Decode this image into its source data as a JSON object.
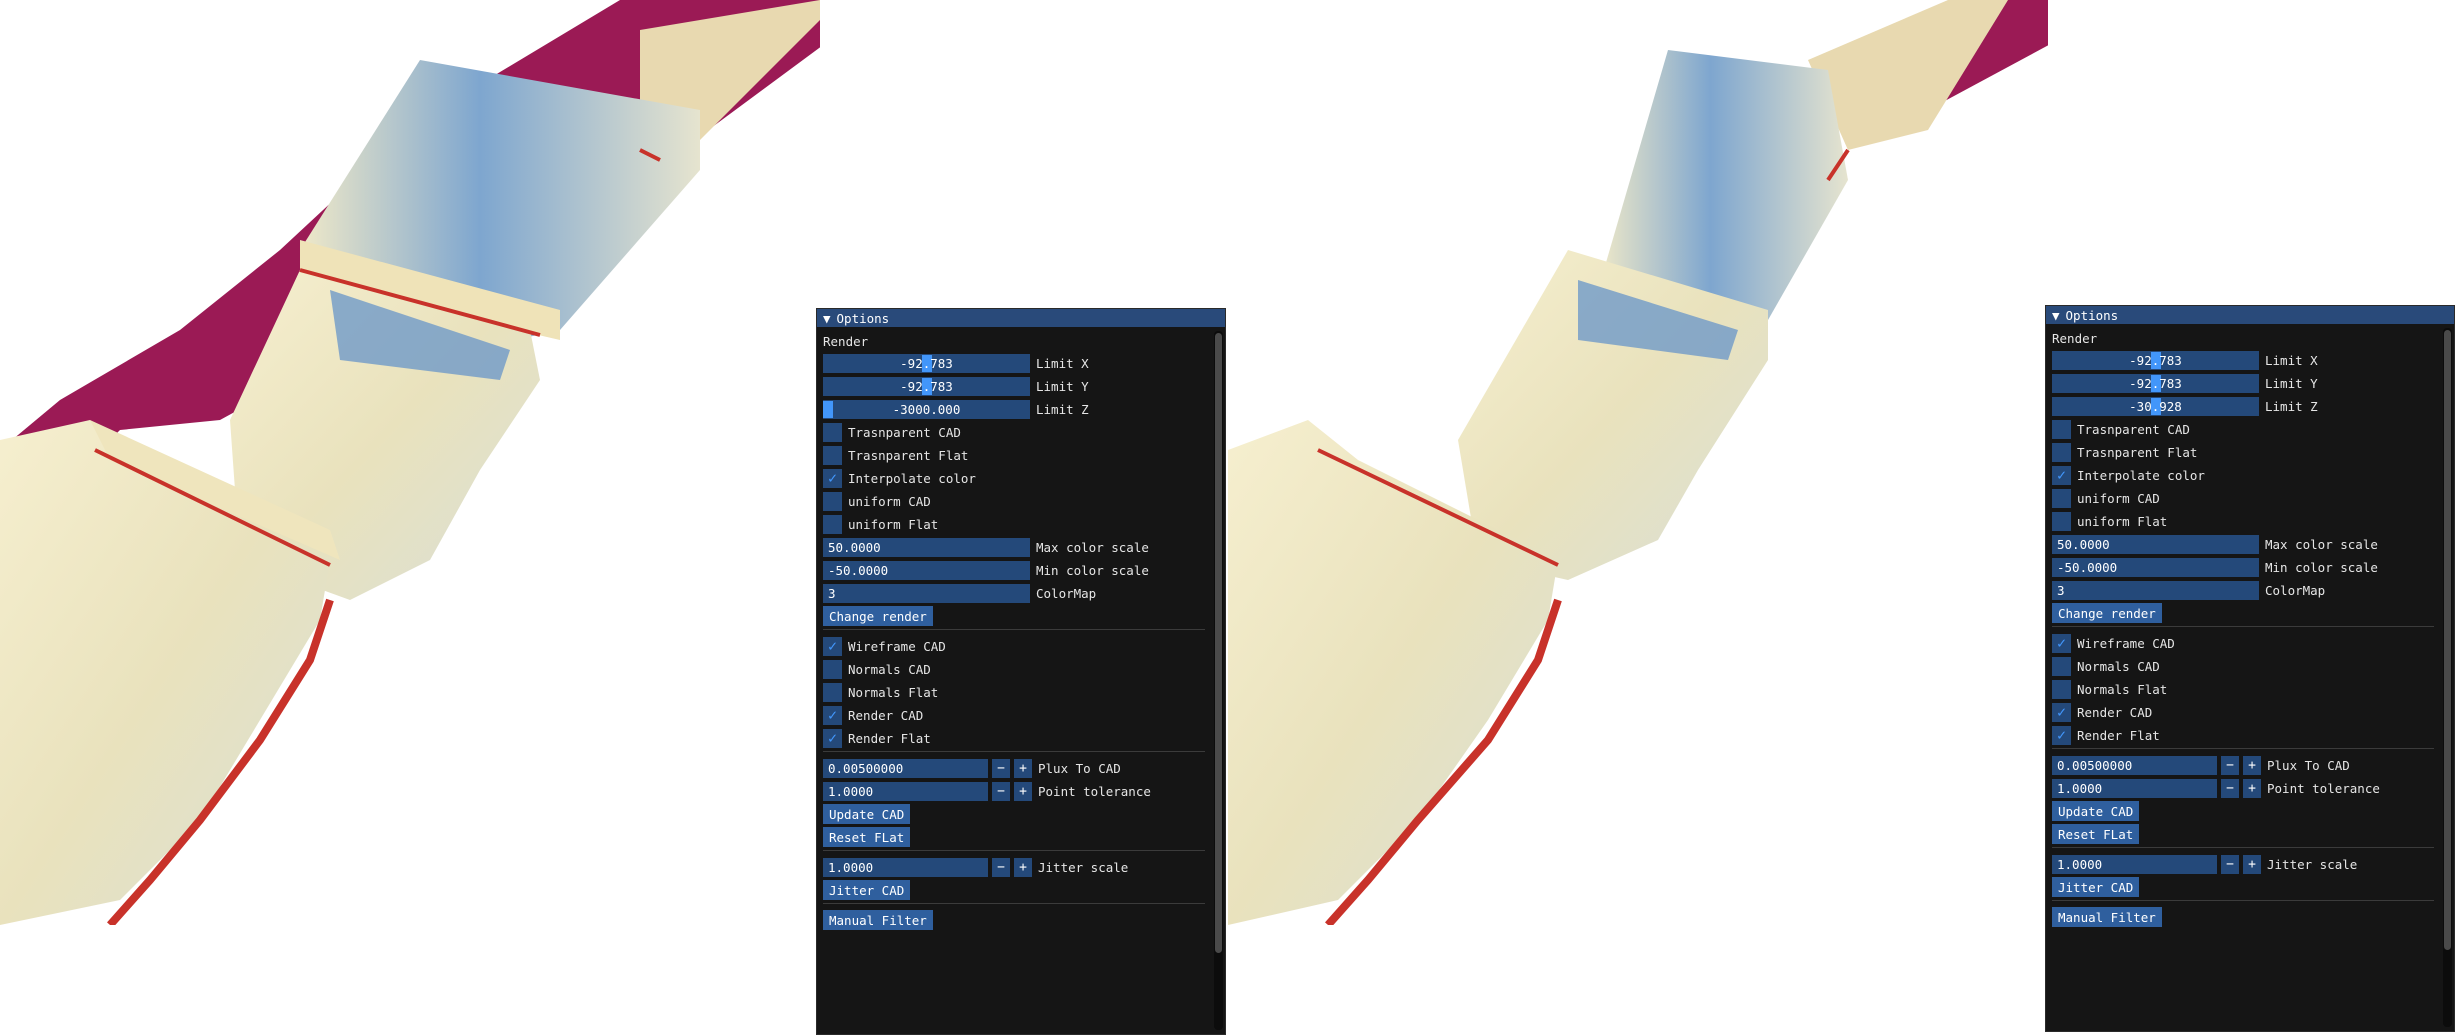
{
  "panels": [
    {
      "title": "Options",
      "render_label": "Render",
      "limits": [
        {
          "value": "-92.783",
          "label": "Limit X",
          "fraction": 0.5
        },
        {
          "value": "-92.783",
          "label": "Limit Y",
          "fraction": 0.5
        },
        {
          "value": "-3000.000",
          "label": "Limit Z",
          "fraction": 0.0
        }
      ],
      "checks_a": [
        {
          "label": "Trasnparent CAD",
          "checked": false
        },
        {
          "label": "Trasnparent Flat",
          "checked": false
        },
        {
          "label": "Interpolate color",
          "checked": true
        },
        {
          "label": "uniform CAD",
          "checked": false
        },
        {
          "label": "uniform Flat",
          "checked": false
        }
      ],
      "inputs": [
        {
          "value": "50.0000",
          "label": "Max color scale"
        },
        {
          "value": "-50.0000",
          "label": "Min color scale"
        },
        {
          "value": "3",
          "label": "ColorMap"
        }
      ],
      "change_render": "Change render",
      "checks_b": [
        {
          "label": "Wireframe CAD",
          "checked": true
        },
        {
          "label": "Normals CAD",
          "checked": false
        },
        {
          "label": "Normals Flat",
          "checked": false
        },
        {
          "label": "Render CAD",
          "checked": true
        },
        {
          "label": "Render Flat",
          "checked": true
        }
      ],
      "steppers": [
        {
          "value": "0.00500000",
          "label": "Plux To CAD"
        },
        {
          "value": "1.0000",
          "label": "Point tolerance"
        }
      ],
      "update_cad": "Update CAD",
      "reset_flat": "Reset FLat",
      "jitter": {
        "value": "1.0000",
        "label": "Jitter scale"
      },
      "jitter_cad": "Jitter CAD",
      "manual_filter": "Manual Filter",
      "minus": "−",
      "plus": "+",
      "check_glyph": "✓"
    },
    {
      "title": "Options",
      "render_label": "Render",
      "limits": [
        {
          "value": "-92.783",
          "label": "Limit X",
          "fraction": 0.5
        },
        {
          "value": "-92.783",
          "label": "Limit Y",
          "fraction": 0.5
        },
        {
          "value": "-30.928",
          "label": "Limit Z",
          "fraction": 0.5
        }
      ],
      "checks_a": [
        {
          "label": "Trasnparent CAD",
          "checked": false
        },
        {
          "label": "Trasnparent Flat",
          "checked": false
        },
        {
          "label": "Interpolate color",
          "checked": true
        },
        {
          "label": "uniform CAD",
          "checked": false
        },
        {
          "label": "uniform Flat",
          "checked": false
        }
      ],
      "inputs": [
        {
          "value": "50.0000",
          "label": "Max color scale"
        },
        {
          "value": "-50.0000",
          "label": "Min color scale"
        },
        {
          "value": "3",
          "label": "ColorMap"
        }
      ],
      "change_render": "Change render",
      "checks_b": [
        {
          "label": "Wireframe CAD",
          "checked": true
        },
        {
          "label": "Normals CAD",
          "checked": false
        },
        {
          "label": "Normals Flat",
          "checked": false
        },
        {
          "label": "Render CAD",
          "checked": true
        },
        {
          "label": "Render Flat",
          "checked": true
        }
      ],
      "steppers": [
        {
          "value": "0.00500000",
          "label": "Plux To CAD"
        },
        {
          "value": "1.0000",
          "label": "Point tolerance"
        }
      ],
      "update_cad": "Update CAD",
      "reset_flat": "Reset FLat",
      "jitter": {
        "value": "1.0000",
        "label": "Jitter scale"
      },
      "jitter_cad": "Jitter CAD",
      "manual_filter": "Manual Filter",
      "minus": "−",
      "plus": "+",
      "check_glyph": "✓"
    }
  ],
  "colors": {
    "panel_bg": "#151515",
    "title_bg": "#294a7a",
    "frame_bg": "#24497a",
    "slider_grab": "#4296fa",
    "button_bg": "#2f5f9e",
    "surface_cream": "#f1e9c6",
    "surface_blue": "#6f9ac8",
    "edge_red": "#c8322a",
    "edge_magenta": "#9b1a55"
  }
}
